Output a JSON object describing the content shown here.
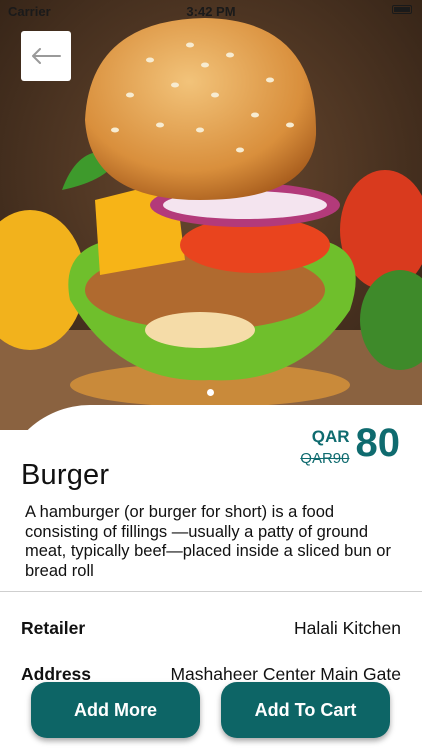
{
  "status_bar": {
    "carrier": "Carrier",
    "time": "3:42 PM"
  },
  "product": {
    "name": "Burger",
    "currency": "QAR",
    "price": "80",
    "old_price": "QAR90",
    "description": "A hamburger (or burger for short) is a food consisting of fillings —usually a patty of ground meat, typically beef—placed inside a sliced bun or bread roll",
    "image_slide": 1,
    "image_slides_total": 1
  },
  "details": [
    {
      "label": "Retailer",
      "value": "Halali Kitchen"
    },
    {
      "label": "Address",
      "value": "Mashaheer Center Main Gate"
    }
  ],
  "actions": {
    "add_more": "Add More",
    "add_to_cart": "Add To Cart"
  },
  "colors": {
    "accent": "#0f6b6f",
    "button": "#0d6566"
  }
}
